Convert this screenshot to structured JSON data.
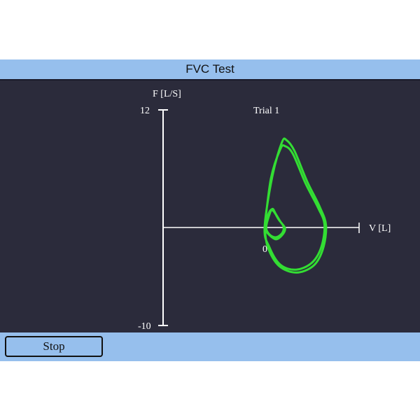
{
  "window": {
    "title": "FVC Test",
    "stop_label": "Stop"
  },
  "chart_data": {
    "type": "line",
    "title": "Trial 1",
    "ylabel": "F [L/S]",
    "xlabel": "V [L]",
    "y_max_label": "12",
    "y_min_label": "-10",
    "origin_label": "0",
    "ylim": [
      -10,
      12
    ],
    "xlim": [
      0,
      4.5
    ],
    "line_color": "#33dd33",
    "series": [
      {
        "values": [
          {
            "x": 0.0,
            "y": 0.0
          },
          {
            "x": 0.2,
            "y": 5.0
          },
          {
            "x": 0.5,
            "y": 8.0
          },
          {
            "x": 0.65,
            "y": 8.3
          },
          {
            "x": 0.9,
            "y": 7.5
          },
          {
            "x": 1.3,
            "y": 4.5
          },
          {
            "x": 1.7,
            "y": 2.0
          },
          {
            "x": 1.9,
            "y": 0.3
          },
          {
            "x": 1.8,
            "y": -2.0
          },
          {
            "x": 1.5,
            "y": -3.6
          },
          {
            "x": 1.0,
            "y": -4.3
          },
          {
            "x": 0.5,
            "y": -3.8
          },
          {
            "x": 0.15,
            "y": -2.0
          },
          {
            "x": 0.0,
            "y": 0.0
          },
          {
            "x": 0.25,
            "y": 5.3
          },
          {
            "x": 0.55,
            "y": 8.7
          },
          {
            "x": 0.7,
            "y": 8.9
          },
          {
            "x": 0.95,
            "y": 7.8
          },
          {
            "x": 1.35,
            "y": 4.7
          },
          {
            "x": 1.75,
            "y": 2.1
          },
          {
            "x": 1.95,
            "y": 0.2
          },
          {
            "x": 1.85,
            "y": -2.2
          },
          {
            "x": 1.55,
            "y": -3.9
          },
          {
            "x": 1.0,
            "y": -4.6
          },
          {
            "x": 0.45,
            "y": -3.9
          },
          {
            "x": 0.1,
            "y": -2.0
          },
          {
            "x": 0.0,
            "y": 0.0
          }
        ]
      },
      {
        "values": [
          {
            "x": 0.0,
            "y": 0.0
          },
          {
            "x": 0.1,
            "y": 1.2
          },
          {
            "x": 0.2,
            "y": 1.8
          },
          {
            "x": 0.3,
            "y": 1.6
          },
          {
            "x": 0.45,
            "y": 0.8
          },
          {
            "x": 0.6,
            "y": 0.1
          },
          {
            "x": 0.55,
            "y": -0.6
          },
          {
            "x": 0.35,
            "y": -1.0
          },
          {
            "x": 0.15,
            "y": -0.7
          },
          {
            "x": 0.05,
            "y": 0.0
          },
          {
            "x": 0.15,
            "y": 1.3
          },
          {
            "x": 0.25,
            "y": 1.9
          },
          {
            "x": 0.35,
            "y": 1.4
          },
          {
            "x": 0.5,
            "y": 0.6
          },
          {
            "x": 0.65,
            "y": -0.1
          },
          {
            "x": 0.55,
            "y": -0.8
          },
          {
            "x": 0.35,
            "y": -1.2
          },
          {
            "x": 0.1,
            "y": -0.6
          },
          {
            "x": 0.0,
            "y": 0.0
          }
        ]
      }
    ]
  }
}
